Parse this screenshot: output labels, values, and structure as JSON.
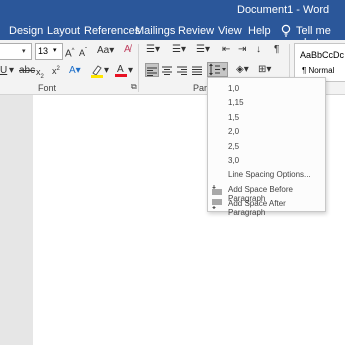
{
  "window": {
    "title": "Document1  -  Word"
  },
  "tabs": [
    "Design",
    "Layout",
    "References",
    "Mailings",
    "Review",
    "View",
    "Help"
  ],
  "tell_me": "Tell me what yo",
  "font": {
    "size": "13",
    "group_label": "Font"
  },
  "paragraph": {
    "group_label": "Paragraph"
  },
  "styles": {
    "sample": "AaBbCcDc",
    "normal_label": "¶ Normal"
  },
  "line_spacing_menu": {
    "values": [
      "1,0",
      "1,15",
      "1,5",
      "2,0",
      "2,5",
      "3,0"
    ],
    "options_label": "Line Spacing Options...",
    "add_before": "Add Space Before Paragraph",
    "add_after": "Add Space After Paragraph"
  },
  "colors": {
    "word_blue": "#2b579a",
    "highlight_yellow": "#ffe600",
    "font_red": "#e81123"
  }
}
